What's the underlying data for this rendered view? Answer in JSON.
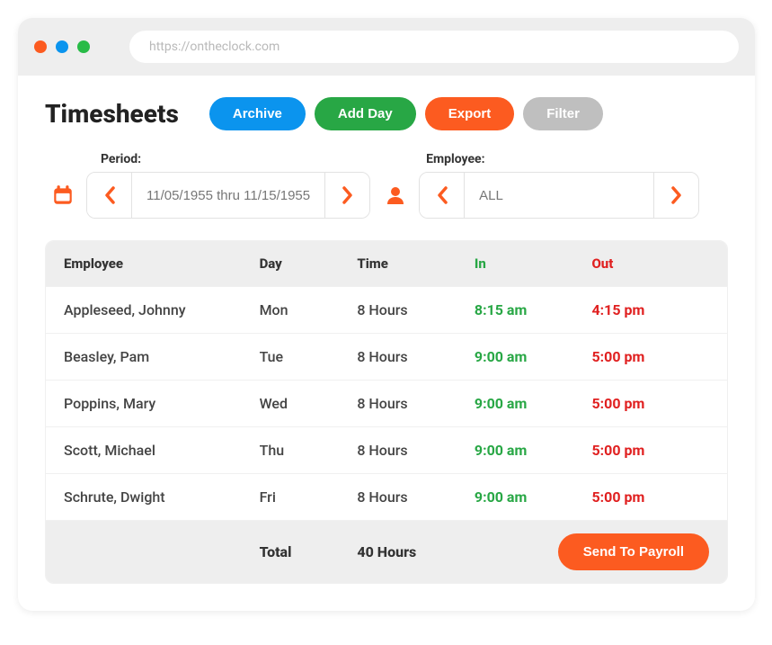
{
  "browser": {
    "url": "https://ontheclock.com"
  },
  "page": {
    "title": "Timesheets"
  },
  "actions": {
    "archive": "Archive",
    "add_day": "Add Day",
    "export": "Export",
    "filter": "Filter"
  },
  "filters": {
    "period_label": "Period:",
    "period_value": "11/05/1955 thru 11/15/1955",
    "employee_label": "Employee:",
    "employee_value": "ALL"
  },
  "table": {
    "headers": {
      "employee": "Employee",
      "day": "Day",
      "time": "Time",
      "in": "In",
      "out": "Out"
    },
    "rows": [
      {
        "employee": "Appleseed, Johnny",
        "day": "Mon",
        "time": "8 Hours",
        "in": "8:15 am",
        "out": "4:15 pm"
      },
      {
        "employee": "Beasley, Pam",
        "day": "Tue",
        "time": "8 Hours",
        "in": "9:00 am",
        "out": "5:00 pm"
      },
      {
        "employee": "Poppins, Mary",
        "day": "Wed",
        "time": "8 Hours",
        "in": "9:00 am",
        "out": "5:00 pm"
      },
      {
        "employee": "Scott, Michael",
        "day": "Thu",
        "time": "8 Hours",
        "in": "9:00 am",
        "out": "5:00 pm"
      },
      {
        "employee": "Schrute, Dwight",
        "day": "Fri",
        "time": "8 Hours",
        "in": "9:00 am",
        "out": "5:00 pm"
      }
    ],
    "footer": {
      "total_label": "Total",
      "total_value": "40 Hours",
      "send_label": "Send To Payroll"
    }
  }
}
